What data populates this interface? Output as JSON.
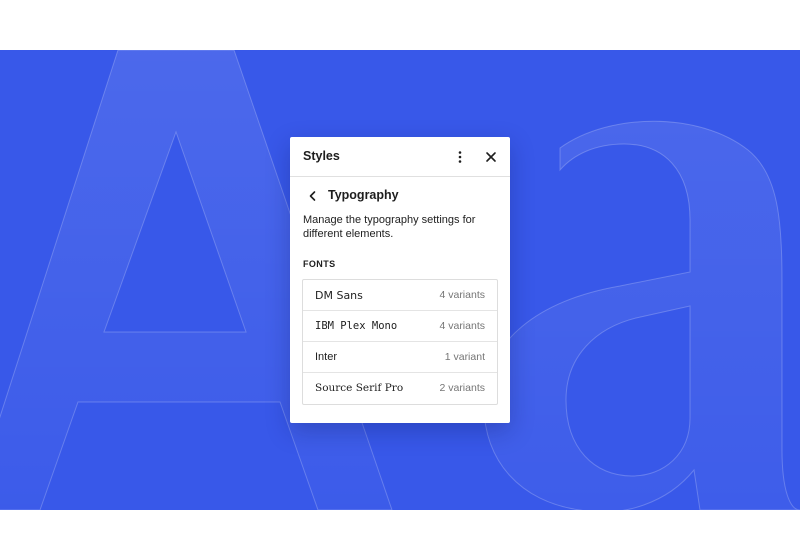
{
  "background": {
    "accent_color": "#3858e9",
    "decorative_glyphs": "Aa"
  },
  "panel": {
    "title": "Styles",
    "more_icon": "more-vertical-icon",
    "close_icon": "close-icon"
  },
  "typography": {
    "back_icon": "chevron-left-icon",
    "title": "Typography",
    "description": "Manage the typography settings for different elements.",
    "fonts_label": "FONTS",
    "fonts": [
      {
        "name": "DM Sans",
        "variants": "4 variants"
      },
      {
        "name": "IBM Plex Mono",
        "variants": "4 variants"
      },
      {
        "name": "Inter",
        "variants": "1 variant"
      },
      {
        "name": "Source Serif Pro",
        "variants": "2 variants"
      }
    ]
  }
}
